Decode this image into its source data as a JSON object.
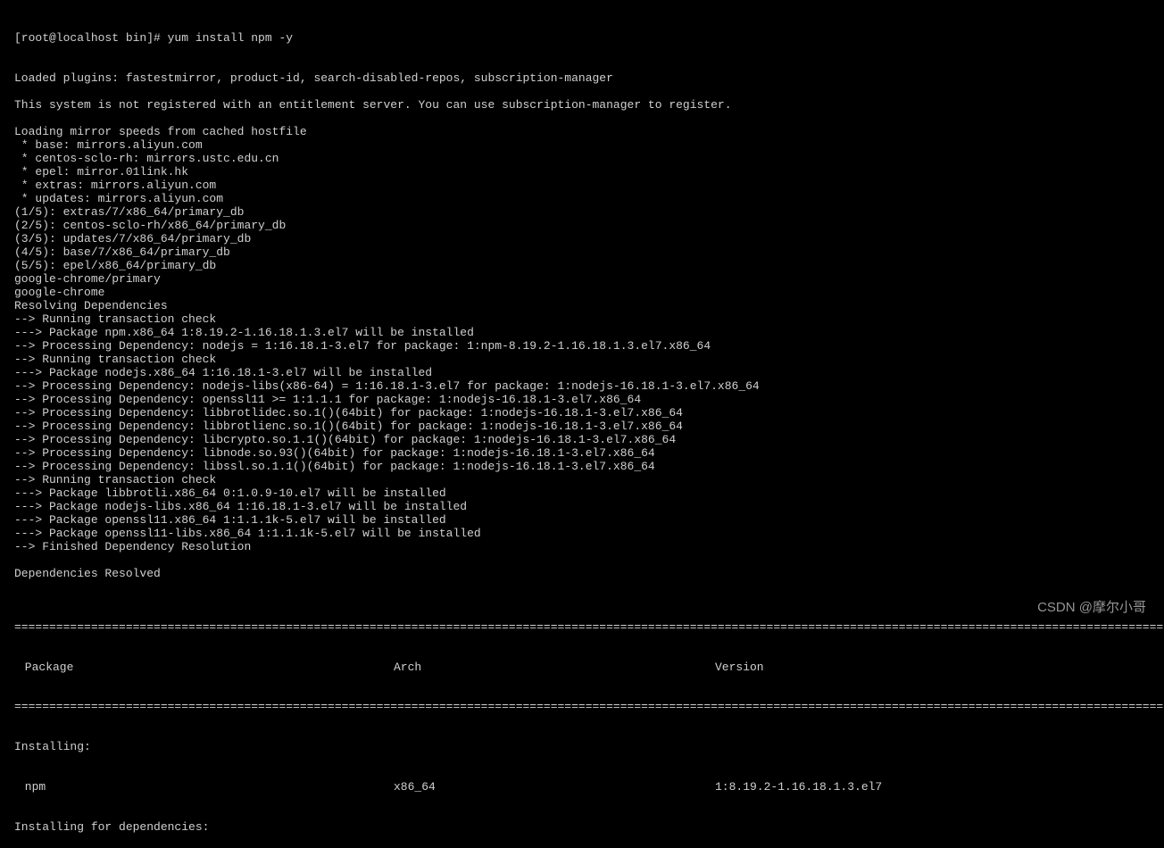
{
  "terminal": {
    "prompt": "[root@localhost bin]# yum install npm -y",
    "lines": [
      "Loaded plugins: fastestmirror, product-id, search-disabled-repos, subscription-manager",
      "",
      "This system is not registered with an entitlement server. You can use subscription-manager to register.",
      "",
      "Loading mirror speeds from cached hostfile",
      " * base: mirrors.aliyun.com",
      " * centos-sclo-rh: mirrors.ustc.edu.cn",
      " * epel: mirror.01link.hk",
      " * extras: mirrors.aliyun.com",
      " * updates: mirrors.aliyun.com",
      "(1/5): extras/7/x86_64/primary_db",
      "(2/5): centos-sclo-rh/x86_64/primary_db",
      "(3/5): updates/7/x86_64/primary_db",
      "(4/5): base/7/x86_64/primary_db",
      "(5/5): epel/x86_64/primary_db",
      "google-chrome/primary",
      "google-chrome",
      "Resolving Dependencies",
      "--> Running transaction check",
      "---> Package npm.x86_64 1:8.19.2-1.16.18.1.3.el7 will be installed",
      "--> Processing Dependency: nodejs = 1:16.18.1-3.el7 for package: 1:npm-8.19.2-1.16.18.1.3.el7.x86_64",
      "--> Running transaction check",
      "---> Package nodejs.x86_64 1:16.18.1-3.el7 will be installed",
      "--> Processing Dependency: nodejs-libs(x86-64) = 1:16.18.1-3.el7 for package: 1:nodejs-16.18.1-3.el7.x86_64",
      "--> Processing Dependency: openssl11 >= 1:1.1.1 for package: 1:nodejs-16.18.1-3.el7.x86_64",
      "--> Processing Dependency: libbrotlidec.so.1()(64bit) for package: 1:nodejs-16.18.1-3.el7.x86_64",
      "--> Processing Dependency: libbrotlienc.so.1()(64bit) for package: 1:nodejs-16.18.1-3.el7.x86_64",
      "--> Processing Dependency: libcrypto.so.1.1()(64bit) for package: 1:nodejs-16.18.1-3.el7.x86_64",
      "--> Processing Dependency: libnode.so.93()(64bit) for package: 1:nodejs-16.18.1-3.el7.x86_64",
      "--> Processing Dependency: libssl.so.1.1()(64bit) for package: 1:nodejs-16.18.1-3.el7.x86_64",
      "--> Running transaction check",
      "---> Package libbrotli.x86_64 0:1.0.9-10.el7 will be installed",
      "---> Package nodejs-libs.x86_64 1:16.18.1-3.el7 will be installed",
      "---> Package openssl11.x86_64 1:1.1.1k-5.el7 will be installed",
      "---> Package openssl11-libs.x86_64 1:1.1.1k-5.el7 will be installed",
      "--> Finished Dependency Resolution",
      "",
      "Dependencies Resolved",
      ""
    ],
    "separator": "=======================================================================================================================================================================================================",
    "header": {
      "package": " Package",
      "arch": "Arch",
      "version": "Version"
    },
    "sections": {
      "installing": "Installing:",
      "installing_deps": "Installing for dependencies:"
    },
    "rows": [
      {
        "package": " npm",
        "arch": "x86_64",
        "version": "1:8.19.2-1.16.18.1.3.el7"
      }
    ]
  },
  "watermark": "CSDN @摩尔小哥"
}
